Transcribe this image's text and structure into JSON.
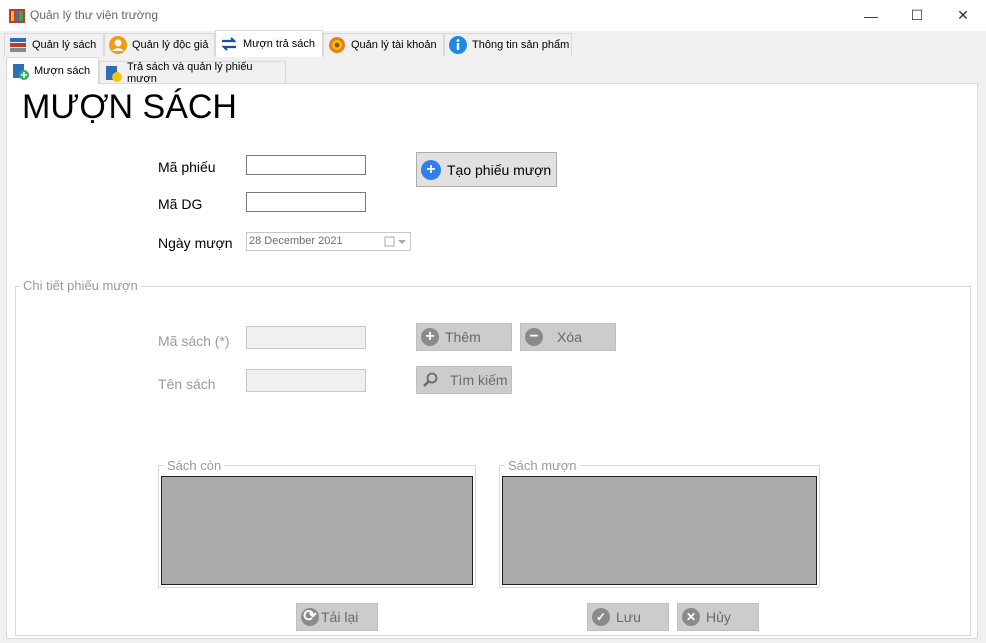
{
  "window": {
    "title": "Quản lý thư viện trường",
    "controls": {
      "minimize": "—",
      "maximize": "☐",
      "close": "✕"
    }
  },
  "main_tabs": [
    {
      "label": "Quản lý sách",
      "icon": "books-icon"
    },
    {
      "label": "Quản lý độc giả",
      "icon": "user-icon"
    },
    {
      "label": "Mượn trả sách",
      "icon": "swap-arrows-icon"
    },
    {
      "label": "Quản lý tài khoản",
      "icon": "gear-icon"
    },
    {
      "label": "Thông tin sản phẩm",
      "icon": "info-icon"
    }
  ],
  "sub_tabs": [
    {
      "label": "Mượn sách",
      "icon": "borrow-icon"
    },
    {
      "label": "Trả sách và quản lý phiếu mượn",
      "icon": "return-icon"
    }
  ],
  "page_title": "MƯỢN SÁCH",
  "form": {
    "ma_phieu_label": "Mã phiếu",
    "ma_phieu_value": "",
    "ma_dg_label": "Mã DG",
    "ma_dg_value": "",
    "ngay_muon_label": "Ngày mượn",
    "ngay_muon_value": "28 December 2021",
    "create_button": "Tạo phiếu mượn"
  },
  "details": {
    "group_title": "Chi tiết phiếu mượn",
    "ma_sach_label": "Mã sách (*)",
    "ten_sach_label": "Tên sách",
    "add_button": "Thêm",
    "delete_button": "Xóa",
    "search_button": "Tìm kiếm",
    "available_title": "Sách còn",
    "borrowed_title": "Sách mượn",
    "reload_button": "Tải lại",
    "save_button": "Lưu",
    "cancel_button": "Hủy"
  },
  "colors": {
    "accent": "#3a8ee6",
    "disabled": "#cccccc",
    "list_bg": "#ababab"
  }
}
